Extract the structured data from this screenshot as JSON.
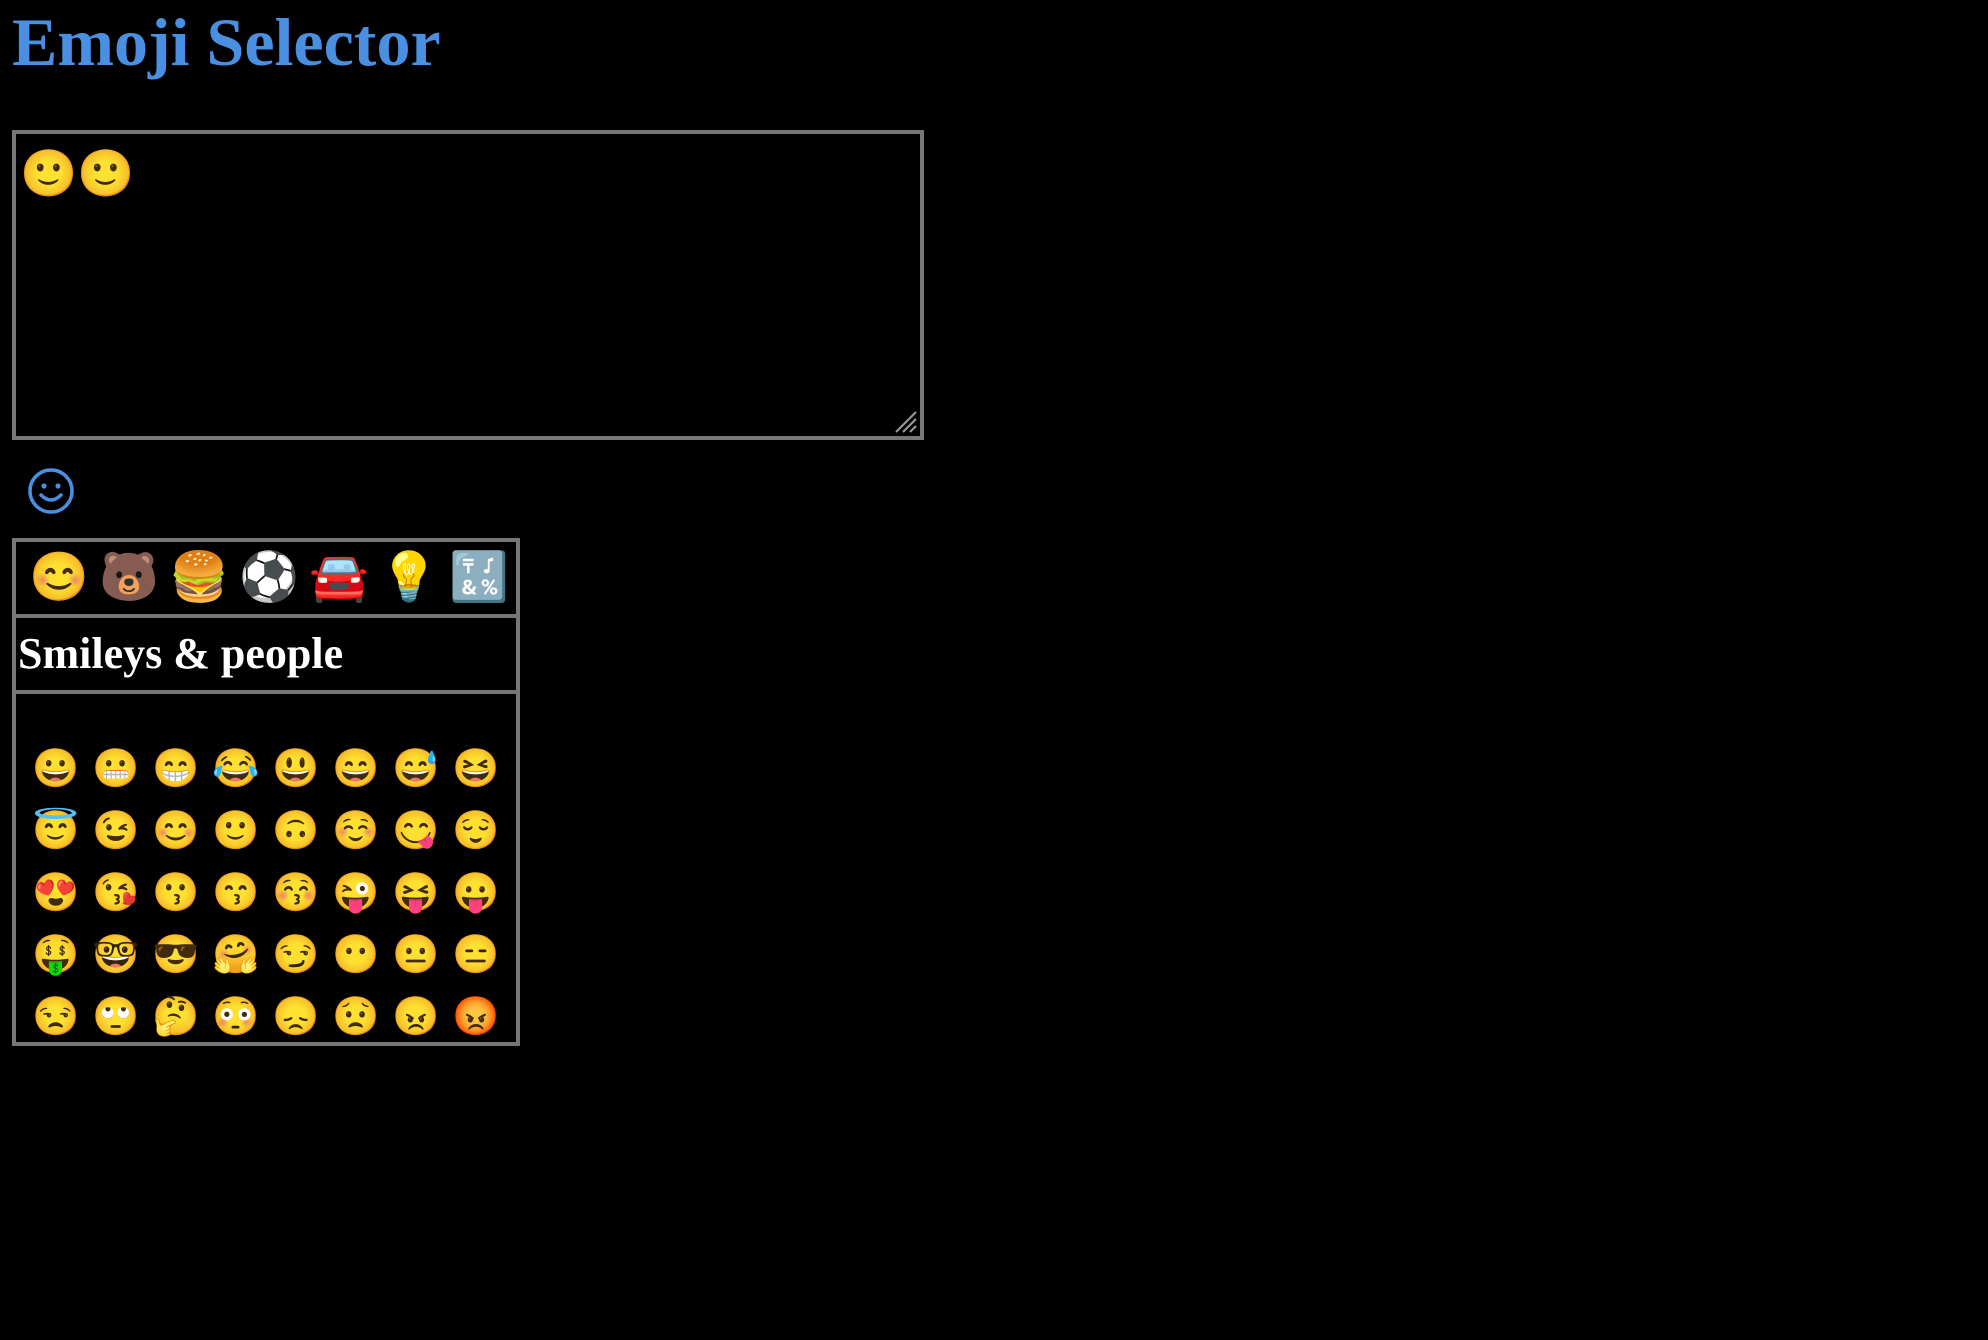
{
  "page": {
    "title": "Emoji Selector"
  },
  "textarea": {
    "value": "🙂🙂"
  },
  "toggle": {
    "icon": "smiley-outline-icon",
    "color": "#4a90e2"
  },
  "picker": {
    "tabs": [
      {
        "emoji": "😊",
        "icon": "smiley-tab-icon"
      },
      {
        "emoji": "🐻",
        "icon": "animal-tab-icon"
      },
      {
        "emoji": "🍔",
        "icon": "food-tab-icon"
      },
      {
        "emoji": "⚽",
        "icon": "activity-tab-icon"
      },
      {
        "emoji": "🚘",
        "icon": "travel-tab-icon"
      },
      {
        "emoji": "💡",
        "icon": "objects-tab-icon"
      },
      {
        "emoji": "🔣",
        "icon": "symbols-tab-icon"
      }
    ],
    "category_title": "Smileys & people",
    "emojis": [
      "😀",
      "😬",
      "😁",
      "😂",
      "😃",
      "😄",
      "😅",
      "😆",
      "😇",
      "😉",
      "😊",
      "🙂",
      "🙃",
      "☺️",
      "😋",
      "😌",
      "😍",
      "😘",
      "😗",
      "😙",
      "😚",
      "😜",
      "😝",
      "😛",
      "🤑",
      "🤓",
      "😎",
      "🤗",
      "😏",
      "😶",
      "😐",
      "😑",
      "😒",
      "🙄",
      "🤔",
      "😳",
      "😞",
      "😟",
      "😠",
      "😡"
    ]
  },
  "colors": {
    "accent": "#4a90e2",
    "border": "#767676",
    "background": "#000000"
  }
}
